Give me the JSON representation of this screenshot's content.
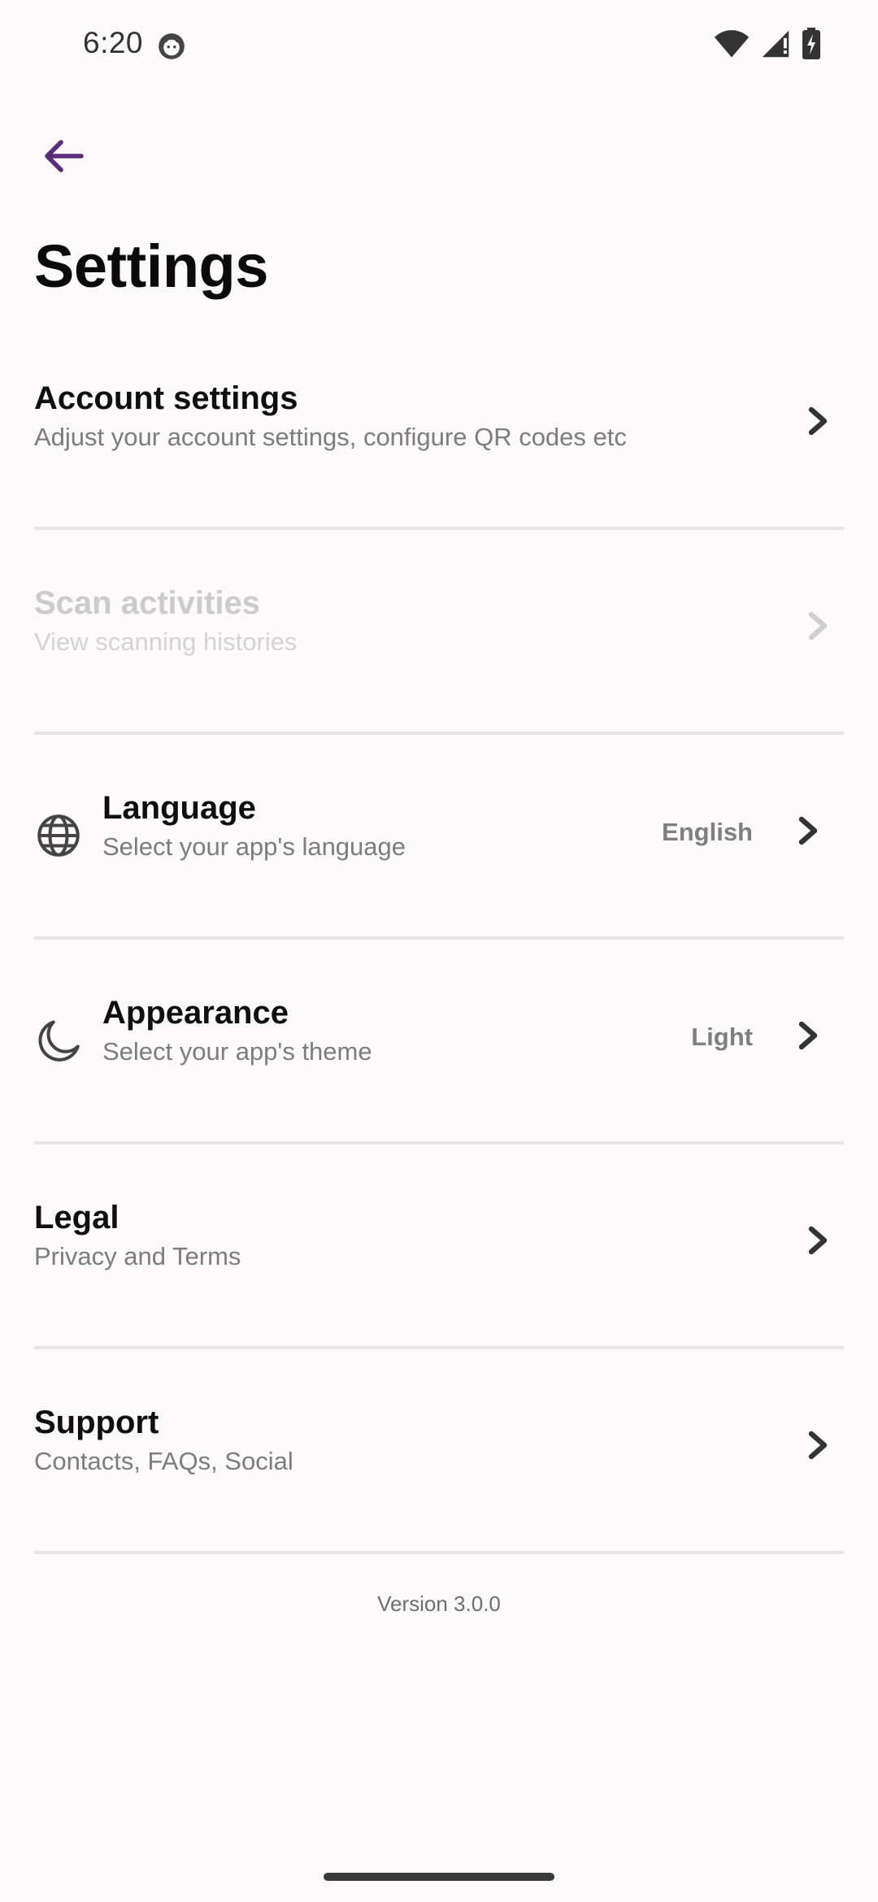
{
  "status_bar": {
    "time": "6:20",
    "icons": [
      "notification-icon",
      "wifi-icon",
      "signal-icon",
      "battery-icon"
    ]
  },
  "header": {
    "back_icon": "back-arrow-icon",
    "title": "Settings",
    "accent_color": "#5a2d7a"
  },
  "settings": {
    "items": [
      {
        "title": "Account settings",
        "subtitle": "Adjust your account settings, configure QR codes etc",
        "value": "",
        "icon": "",
        "enabled": true
      },
      {
        "title": "Scan activities",
        "subtitle": "View scanning histories",
        "value": "",
        "icon": "",
        "enabled": false
      },
      {
        "title": "Language",
        "subtitle": "Select your app's language",
        "value": "English",
        "icon": "globe-icon",
        "enabled": true
      },
      {
        "title": "Appearance",
        "subtitle": "Select your app's theme",
        "value": "Light",
        "icon": "moon-icon",
        "enabled": true
      },
      {
        "title": "Legal",
        "subtitle": "Privacy and Terms",
        "value": "",
        "icon": "",
        "enabled": true
      },
      {
        "title": "Support",
        "subtitle": "Contacts, FAQs, Social",
        "value": "",
        "icon": "",
        "enabled": true
      }
    ]
  },
  "footer": {
    "version": "Version 3.0.0"
  }
}
